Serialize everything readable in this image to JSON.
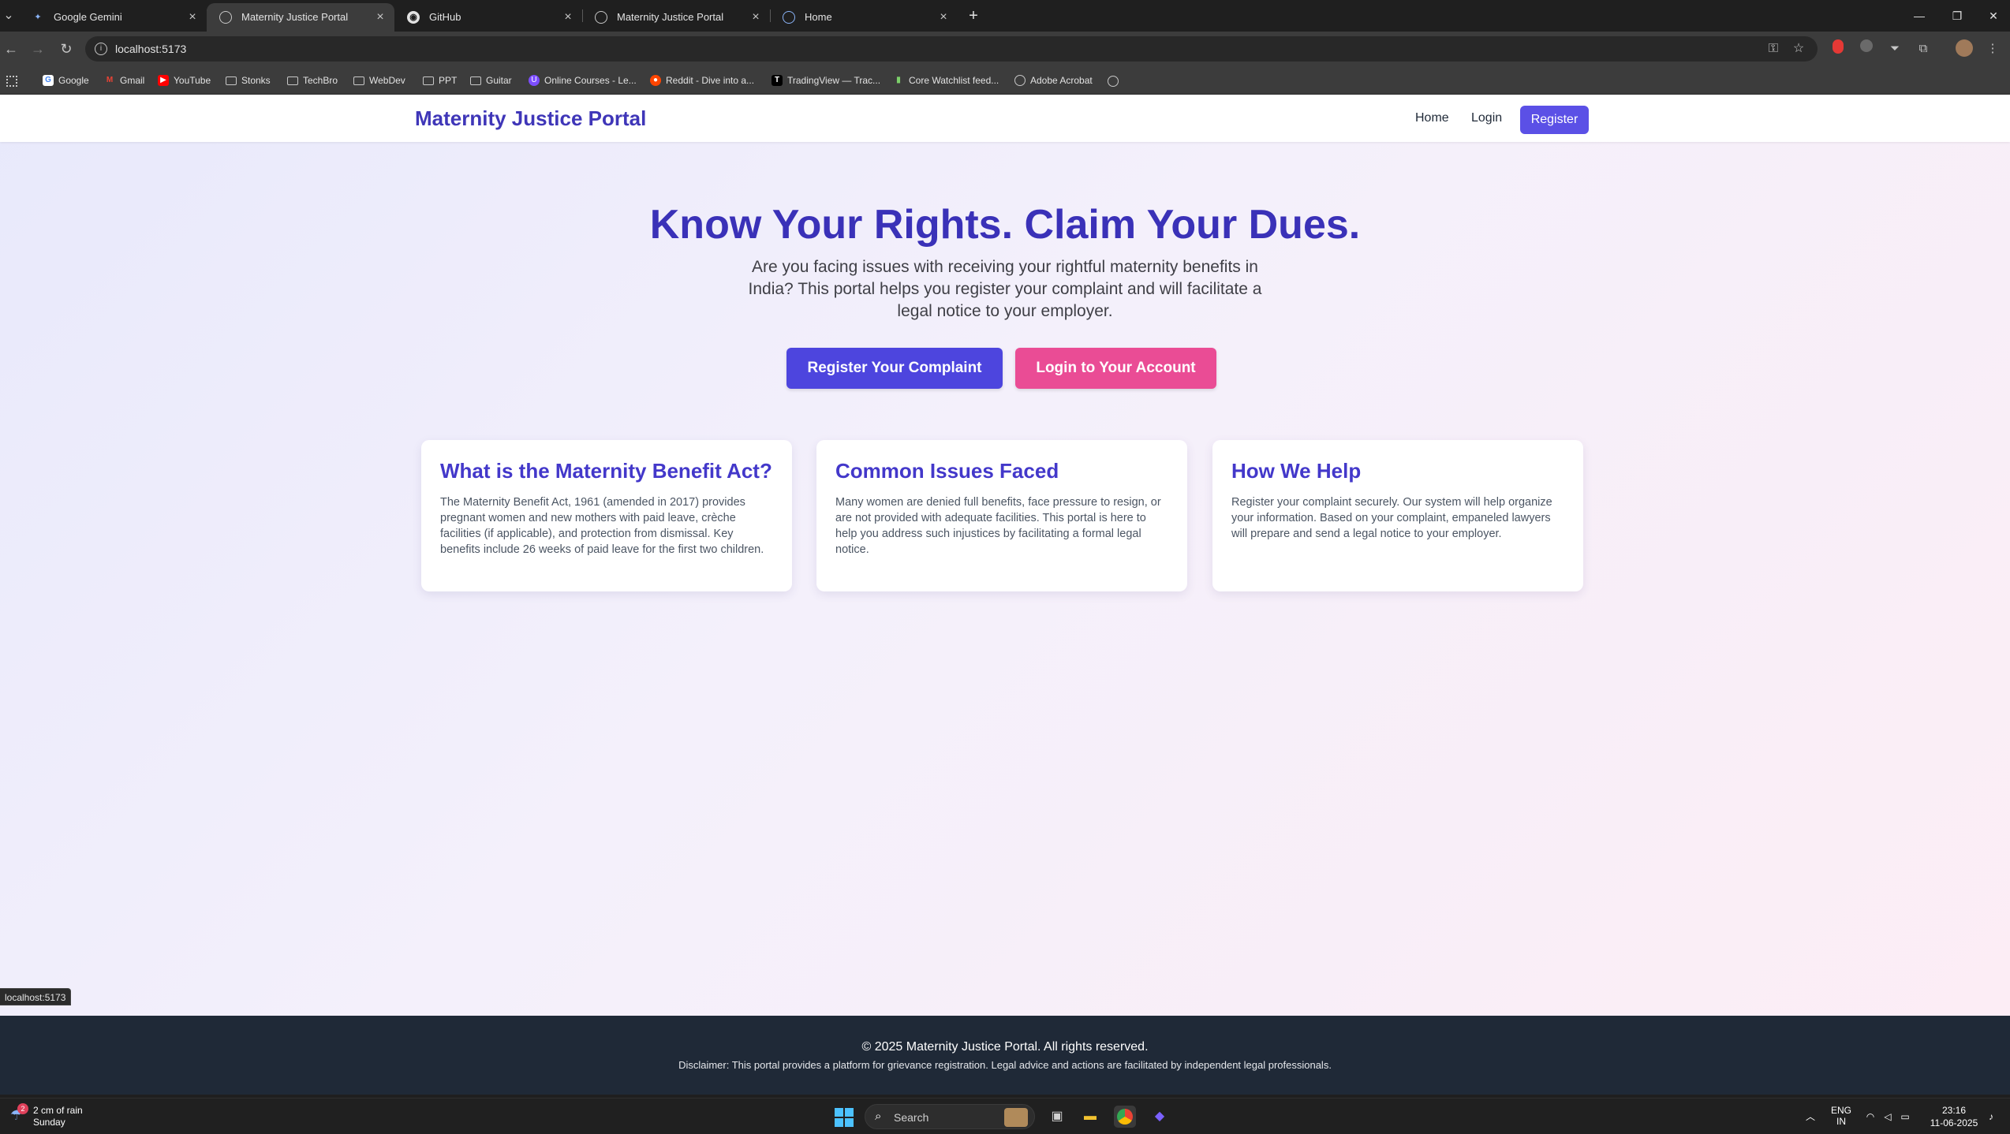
{
  "browser": {
    "tabs": [
      {
        "title": "Google Gemini",
        "icon": "gemini-icon",
        "active": false
      },
      {
        "title": "Maternity Justice Portal",
        "icon": "globe-icon",
        "active": true
      },
      {
        "title": "GitHub",
        "icon": "github-icon",
        "active": false
      },
      {
        "title": "Maternity Justice Portal",
        "icon": "globe-icon",
        "active": false
      },
      {
        "title": "Home",
        "icon": "home-app-icon",
        "active": false
      }
    ],
    "url": "localhost:5173",
    "bookmarks": [
      {
        "label": "Google",
        "icon": "google-icon"
      },
      {
        "label": "Gmail",
        "icon": "gmail-icon"
      },
      {
        "label": "YouTube",
        "icon": "youtube-icon"
      },
      {
        "label": "Stonks",
        "icon": "folder-icon"
      },
      {
        "label": "TechBro",
        "icon": "folder-icon"
      },
      {
        "label": "WebDev",
        "icon": "folder-icon"
      },
      {
        "label": "PPT",
        "icon": "folder-icon"
      },
      {
        "label": "Guitar",
        "icon": "folder-icon"
      },
      {
        "label": "Online Courses - Le...",
        "icon": "course-icon"
      },
      {
        "label": "Reddit - Dive into a...",
        "icon": "reddit-icon"
      },
      {
        "label": "TradingView — Trac...",
        "icon": "tradingview-icon"
      },
      {
        "label": "Core Watchlist feed...",
        "icon": "chart-icon"
      },
      {
        "label": "Adobe Acrobat",
        "icon": "globe-icon"
      }
    ],
    "status_url": "localhost:5173"
  },
  "site": {
    "brand": "Maternity Justice Portal",
    "nav": {
      "home": "Home",
      "login": "Login",
      "register": "Register"
    },
    "hero": {
      "title": "Know Your Rights. Claim Your Dues.",
      "text": "Are you facing issues with receiving your rightful maternity benefits in India? This portal helps you register your complaint and will facilitate a legal notice to your employer.",
      "primary_button": "Register Your Complaint",
      "secondary_button": "Login to Your Account"
    },
    "cards": [
      {
        "title": "What is the Maternity Benefit Act?",
        "body": "The Maternity Benefit Act, 1961 (amended in 2017) provides pregnant women and new mothers with paid leave, crèche facilities (if applicable), and protection from dismissal. Key benefits include 26 weeks of paid leave for the first two children."
      },
      {
        "title": "Common Issues Faced",
        "body": "Many women are denied full benefits, face pressure to resign, or are not provided with adequate facilities. This portal is here to help you address such injustices by facilitating a formal legal notice."
      },
      {
        "title": "How We Help",
        "body": "Register your complaint securely. Our system will help organize your information. Based on your complaint, empaneled lawyers will prepare and send a legal notice to your employer."
      }
    ],
    "footer": {
      "copyright": "© 2025 Maternity Justice Portal. All rights reserved.",
      "disclaimer": "Disclaimer: This portal provides a platform for grievance registration. Legal advice and actions are facilitated by independent legal professionals."
    },
    "colors": {
      "brand": "#3f36b8",
      "primary": "#4d45de",
      "secondary": "#ea4c95",
      "footer": "#1f2937"
    }
  },
  "taskbar": {
    "weather_line1": "2 cm of rain",
    "weather_line2": "Sunday",
    "weather_badge": "2",
    "search": "Search",
    "lang_line1": "ENG",
    "lang_line2": "IN",
    "time": "23:16",
    "date": "11-06-2025"
  }
}
